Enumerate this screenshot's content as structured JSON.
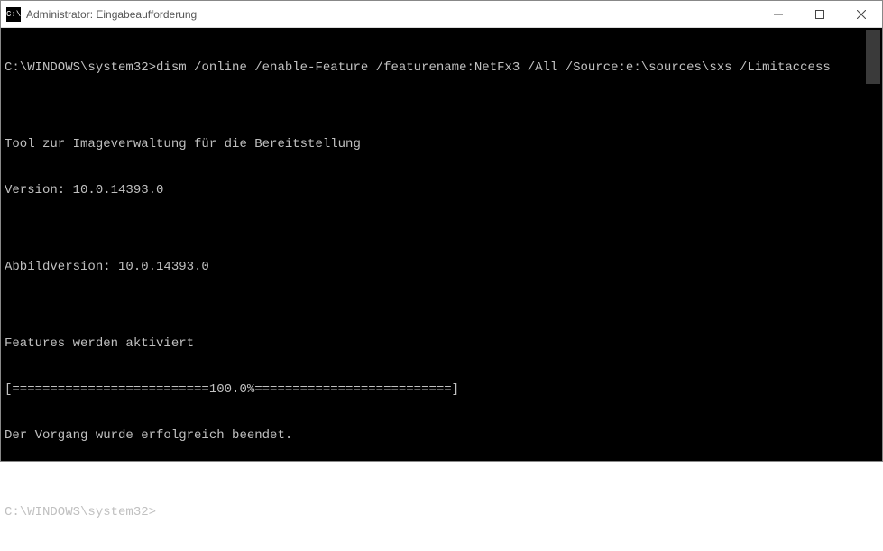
{
  "window": {
    "title": "Administrator: Eingabeaufforderung",
    "icon_glyph": "C:\\"
  },
  "terminal": {
    "prompt1": "C:\\WINDOWS\\system32>",
    "command": "dism /online /enable-Feature /featurename:NetFx3 /All /Source:e:\\sources\\sxs /Limitaccess",
    "blank1": "",
    "tool_line": "Tool zur Imageverwaltung für die Bereitstellung",
    "version_line": "Version: 10.0.14393.0",
    "blank2": "",
    "image_version": "Abbildversion: 10.0.14393.0",
    "blank3": "",
    "features_line": "Features werden aktiviert",
    "progress_bar": "[==========================100.0%==========================]",
    "success_line": "Der Vorgang wurde erfolgreich beendet.",
    "blank4": "",
    "prompt2": "C:\\WINDOWS\\system32>"
  }
}
